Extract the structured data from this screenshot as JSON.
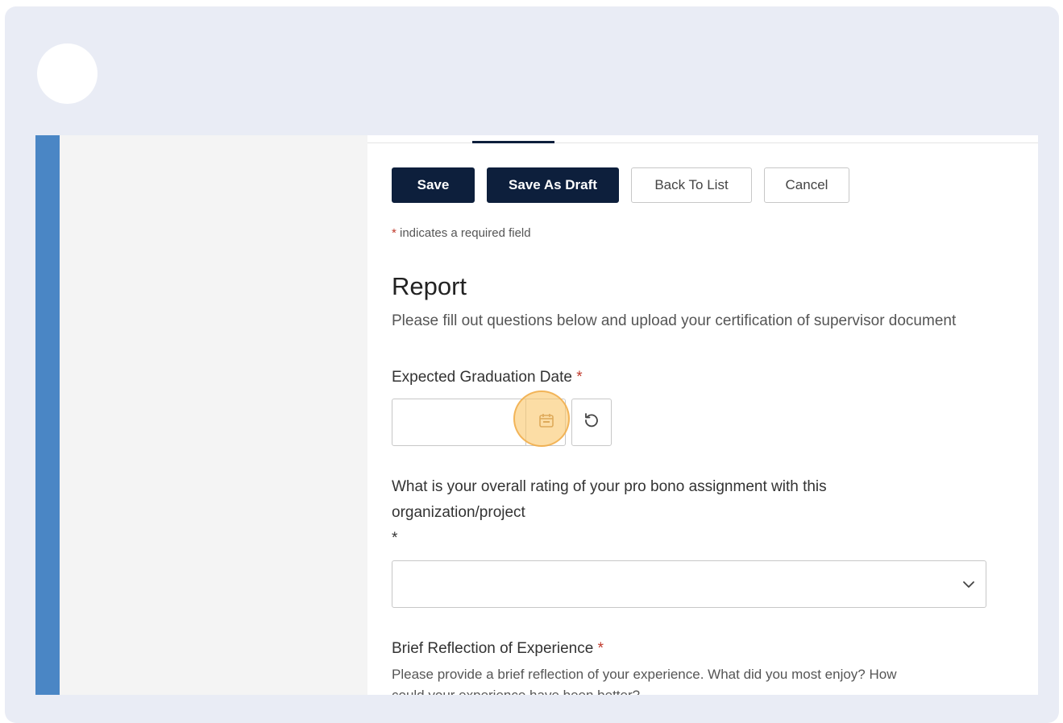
{
  "toolbar": {
    "save_label": "Save",
    "save_draft_label": "Save As Draft",
    "back_label": "Back To List",
    "cancel_label": "Cancel"
  },
  "required_note": {
    "star": "*",
    "text": " indicates a required field"
  },
  "section": {
    "title": "Report",
    "description": "Please fill out questions below and upload your certification of supervisor document"
  },
  "fields": {
    "graduation": {
      "label": "Expected Graduation Date",
      "required_mark": "*",
      "value": ""
    },
    "rating": {
      "label_line1": "What is your overall rating of your pro bono assignment with this",
      "label_line2": "organization/project",
      "required_mark": "*",
      "selected": ""
    },
    "reflection": {
      "label": "Brief Reflection of Experience",
      "required_mark": "*",
      "help_line1": "Please provide a brief reflection of your experience. What did you most enjoy? How",
      "help_line2": "could your experience have been better?"
    }
  },
  "icons": {
    "calendar": "calendar-icon",
    "reset": "reset-icon",
    "dropdown": "chevron-down-icon"
  },
  "colors": {
    "primary": "#0d1f3c",
    "accent_strip": "#4a86c5",
    "required": "#c0392b",
    "highlight": "#f8c46e"
  }
}
